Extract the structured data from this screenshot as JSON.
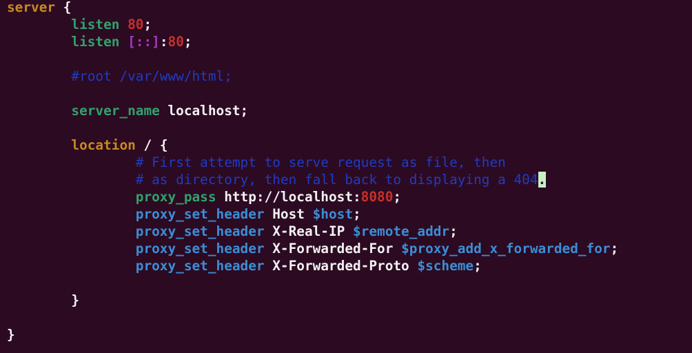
{
  "editor": {
    "lines": [
      [
        {
          "t": "server",
          "c": "kw-orange"
        },
        {
          "t": " {",
          "c": "plain"
        }
      ],
      [
        {
          "t": "        listen ",
          "c": "kw-green"
        },
        {
          "t": "80",
          "c": "num-red"
        },
        {
          "t": ";",
          "c": "plain"
        }
      ],
      [
        {
          "t": "        listen ",
          "c": "kw-green"
        },
        {
          "t": "[::]",
          "c": "purple"
        },
        {
          "t": ":",
          "c": "plain"
        },
        {
          "t": "80",
          "c": "num-red"
        },
        {
          "t": ";",
          "c": "plain"
        }
      ],
      [],
      [
        {
          "t": "        #root /var/www/html;",
          "c": "comment"
        }
      ],
      [],
      [
        {
          "t": "        server_name ",
          "c": "kw-green"
        },
        {
          "t": "localhost;",
          "c": "plain"
        }
      ],
      [],
      [
        {
          "t": "        location ",
          "c": "kw-orange"
        },
        {
          "t": "/ {",
          "c": "plain"
        }
      ],
      [
        {
          "t": "                # First attempt to serve request as file, then",
          "c": "comment"
        }
      ],
      [
        {
          "t": "                # as directory, then fall back to displaying a 404",
          "c": "comment"
        },
        {
          "t": ".",
          "c": "cursor"
        }
      ],
      [
        {
          "t": "                proxy_pass ",
          "c": "kw-green"
        },
        {
          "t": "http://localhost:",
          "c": "plain"
        },
        {
          "t": "8080",
          "c": "num-red"
        },
        {
          "t": ";",
          "c": "plain"
        }
      ],
      [
        {
          "t": "                proxy_set_header ",
          "c": "kw-blue"
        },
        {
          "t": "Host ",
          "c": "plain"
        },
        {
          "t": "$host",
          "c": "var-blue"
        },
        {
          "t": ";",
          "c": "plain"
        }
      ],
      [
        {
          "t": "                proxy_set_header ",
          "c": "kw-blue"
        },
        {
          "t": "X-Real-IP ",
          "c": "plain"
        },
        {
          "t": "$remote_addr",
          "c": "var-blue"
        },
        {
          "t": ";",
          "c": "plain"
        }
      ],
      [
        {
          "t": "                proxy_set_header ",
          "c": "kw-blue"
        },
        {
          "t": "X-Forwarded-For ",
          "c": "plain"
        },
        {
          "t": "$proxy_add_x_forwarded_for",
          "c": "var-blue"
        },
        {
          "t": ";",
          "c": "plain"
        }
      ],
      [
        {
          "t": "                proxy_set_header ",
          "c": "kw-blue"
        },
        {
          "t": "X-Forwarded-Proto ",
          "c": "plain"
        },
        {
          "t": "$scheme",
          "c": "var-blue"
        },
        {
          "t": ";",
          "c": "plain"
        }
      ],
      [],
      [
        {
          "t": "        }",
          "c": "plain"
        }
      ],
      [],
      [
        {
          "t": "}",
          "c": "plain"
        }
      ]
    ]
  },
  "colors": {
    "background": "#2c0a22",
    "keyword_orange": "#c98a1e",
    "keyword_green": "#2fa36b",
    "keyword_blue": "#3b8ed6",
    "number_red": "#c8302a",
    "comment_blue": "#1f3cc4",
    "cursor": "#c8f0c8"
  }
}
